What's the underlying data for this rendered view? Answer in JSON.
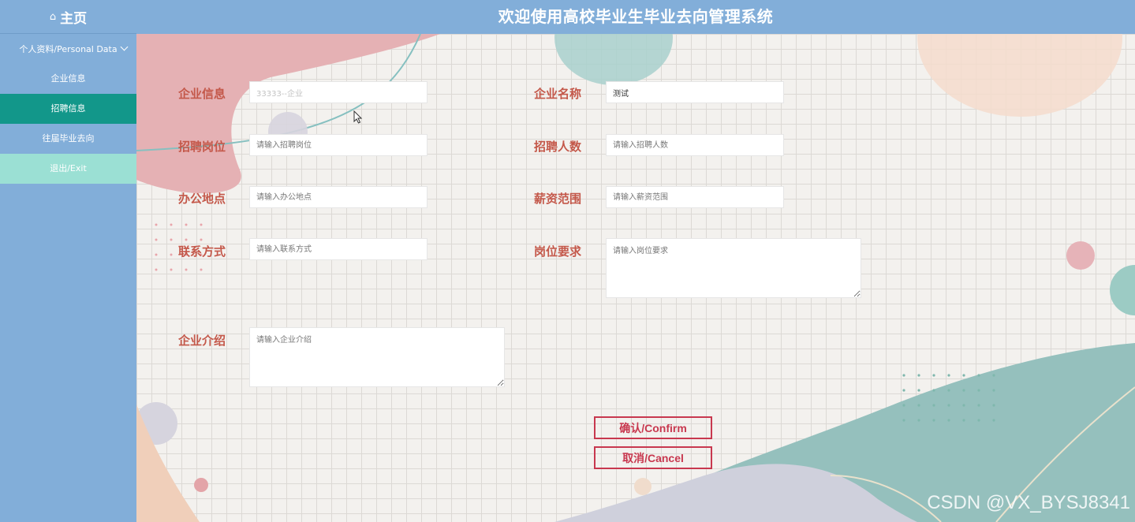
{
  "header": {
    "home_icon": "home-icon",
    "home_label": "主页",
    "system_title": "欢迎使用高校毕业生毕业去向管理系统"
  },
  "sidebar": {
    "group_label": "个人资料/Personal Data",
    "items": [
      {
        "label": "企业信息"
      },
      {
        "label": "招聘信息"
      },
      {
        "label": "往届毕业去向"
      },
      {
        "label": "退出/Exit"
      }
    ]
  },
  "form": {
    "company_info": {
      "label": "企业信息",
      "value": "33333--企业"
    },
    "company_name": {
      "label": "企业名称",
      "value": "测试"
    },
    "position": {
      "label": "招聘岗位",
      "placeholder": "请输入招聘岗位"
    },
    "headcount": {
      "label": "招聘人数",
      "placeholder": "请输入招聘人数"
    },
    "location": {
      "label": "办公地点",
      "placeholder": "请输入办公地点"
    },
    "salary": {
      "label": "薪资范围",
      "placeholder": "请输入薪资范围"
    },
    "contact": {
      "label": "联系方式",
      "placeholder": "请输入联系方式"
    },
    "requirements": {
      "label": "岗位要求",
      "placeholder": "请输入岗位要求"
    },
    "intro": {
      "label": "企业介绍",
      "placeholder": "请输入企业介绍"
    }
  },
  "buttons": {
    "confirm": "确认/Confirm",
    "cancel": "取消/Cancel"
  },
  "watermark": "CSDN @VX_BYSJ8341",
  "colors": {
    "header_bg": "#82aed9",
    "active_item": "#12978a",
    "exit_item": "#9be0d4",
    "label": "#c4584a",
    "button": "#c8384f"
  }
}
